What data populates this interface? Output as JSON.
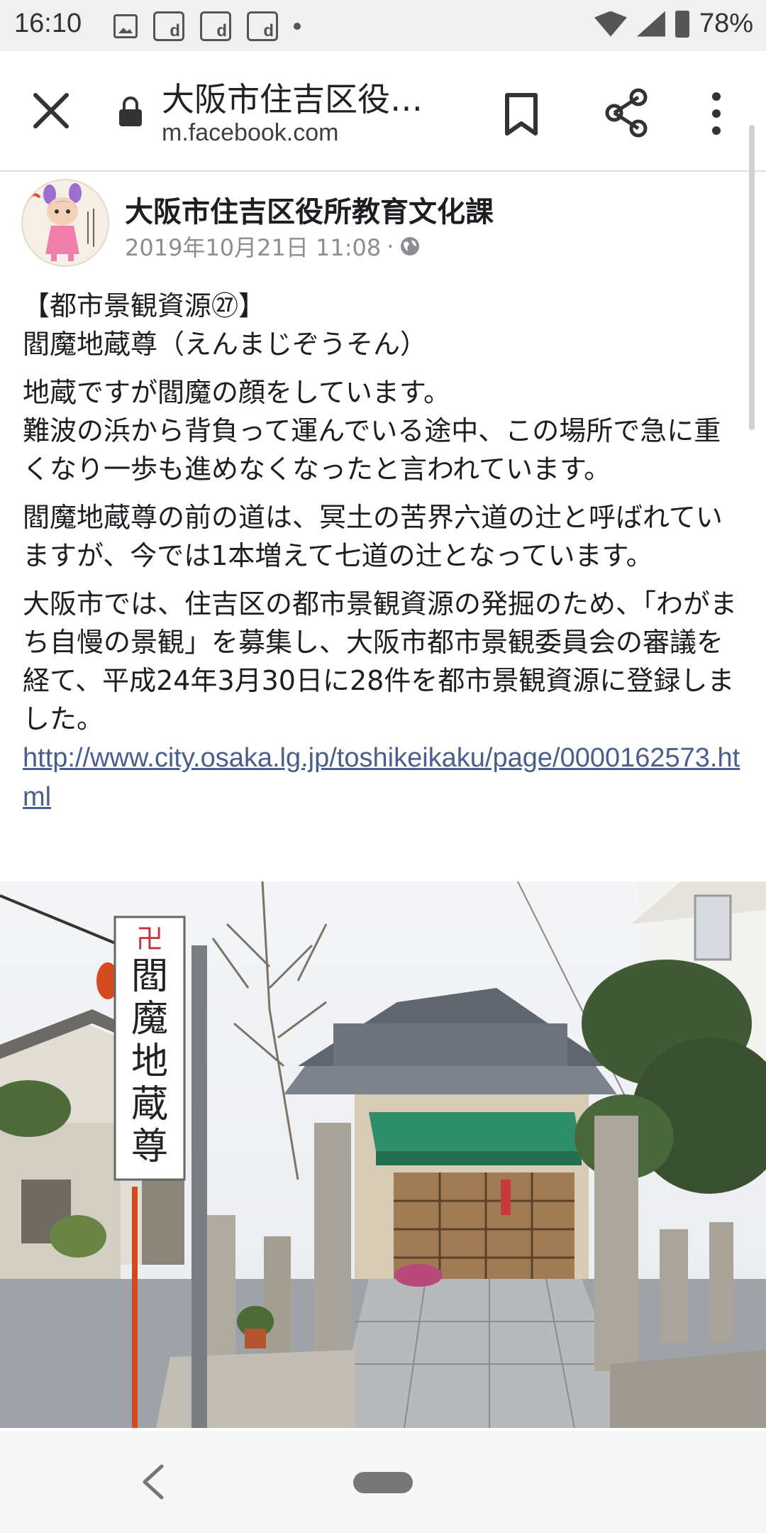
{
  "status_bar": {
    "time": "16:10",
    "battery_percent": "78%",
    "notification_icons": [
      "picture-icon",
      "app-d-icon",
      "app-d-icon",
      "app-d-icon",
      "dot-icon"
    ],
    "right_icons": [
      "wifi-icon",
      "signal-icon",
      "battery-icon"
    ]
  },
  "browser": {
    "title": "大阪市住吉区役…",
    "url": "m.facebook.com",
    "icons": [
      "close-icon",
      "lock-icon",
      "bookmark-icon",
      "share-icon",
      "more-vert-icon"
    ]
  },
  "post": {
    "author": "大阪市住吉区役所教育文化課",
    "date": "2019年10月21日 11:08",
    "separator": "·",
    "privacy_icon": "globe-icon",
    "paragraphs": [
      "【都市景観資源㉗】\n閻魔地蔵尊（えんまじぞうそん）",
      "地蔵ですが閻魔の顔をしています。\n難波の浜から背負って運んでいる途中、この場所で急に重くなり一歩も進めなくなったと言われています。",
      "閻魔地蔵尊の前の道は、冥土の苦界六道の辻と呼ばれていますが、今では1本増えて七道の辻となっています。",
      "大阪市では、住吉区の都市景観資源の発掘のため、「わがまち自慢の景観」を募集し、大阪市都市景観委員会の審議を経て、平成24年3月30日に28件を都市景観資源に登録しました。"
    ],
    "link": "http://www.city.osaka.lg.jp/toshikeikaku/page/0000162573.html",
    "photo": {
      "sign_chars": [
        "閻",
        "魔",
        "地",
        "蔵",
        "尊"
      ],
      "sign_symbol": "卍"
    }
  },
  "nav_bar": {
    "icons": [
      "back-nav-icon",
      "home-pill"
    ]
  }
}
